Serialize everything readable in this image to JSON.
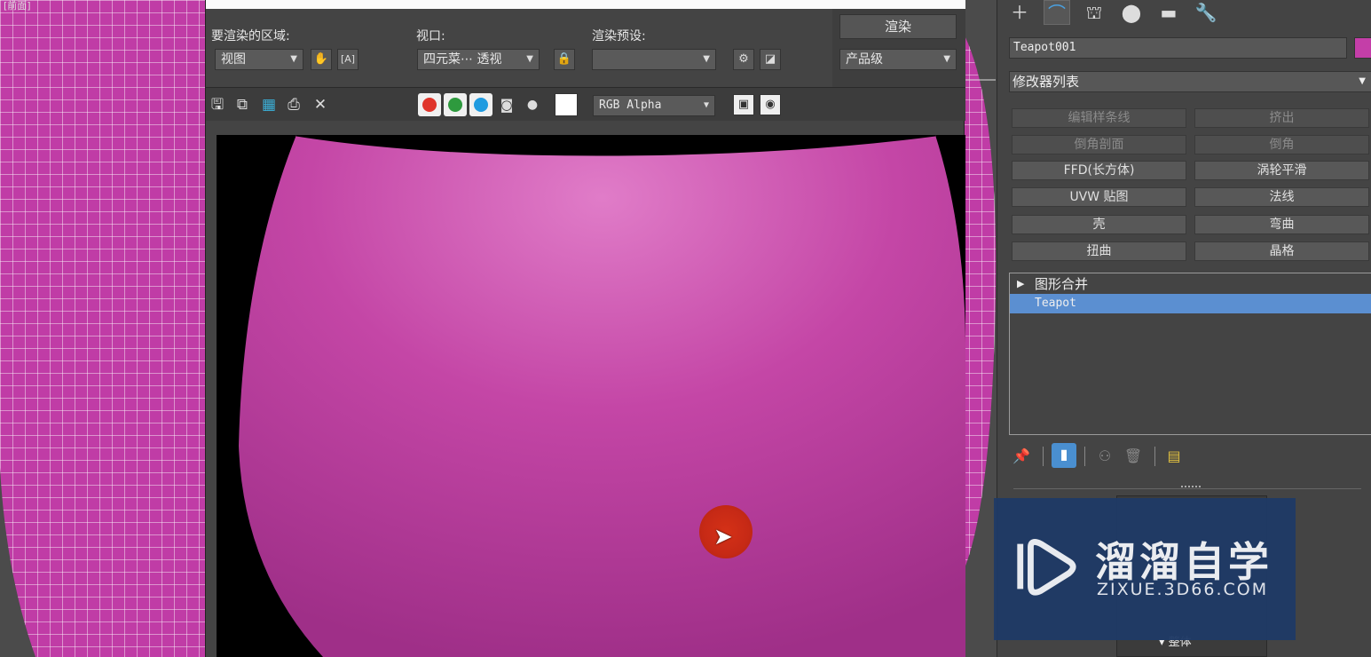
{
  "viewport": {
    "corner_label": "[前面]"
  },
  "frame_window": {
    "region_label": "要渲染的区域:",
    "region_value": "视图",
    "viewport_label": "视口:",
    "viewport_value": "四元菜⋯ 透视",
    "preset_label": "渲染预设:",
    "preset_value": "",
    "render_button": "渲染",
    "quality_value": "产品级",
    "channel_value": "RGB Alpha",
    "colors": {
      "red": "#e0352b",
      "green": "#2e9a3e",
      "blue": "#1f9be0",
      "object": "#c447a8"
    }
  },
  "command_panel": {
    "object_name": "Teapot001",
    "object_color": "#c43ea8",
    "modifier_list_label": "修改器列表",
    "modifier_buttons": [
      {
        "label": "编辑样条线",
        "enabled": false
      },
      {
        "label": "挤出",
        "enabled": false
      },
      {
        "label": "倒角剖面",
        "enabled": false
      },
      {
        "label": "倒角",
        "enabled": false
      },
      {
        "label": "FFD(长方体)",
        "enabled": true
      },
      {
        "label": "涡轮平滑",
        "enabled": true
      },
      {
        "label": "UVW 贴图",
        "enabled": true
      },
      {
        "label": "法线",
        "enabled": true
      },
      {
        "label": "壳",
        "enabled": true
      },
      {
        "label": "弯曲",
        "enabled": true
      },
      {
        "label": "扭曲",
        "enabled": true
      },
      {
        "label": "晶格",
        "enabled": true
      }
    ],
    "stack": [
      {
        "label": "图形合并",
        "selected": false
      },
      {
        "label": "Teapot",
        "selected": true
      }
    ],
    "bottom_rollout_label": "整体"
  },
  "watermark": {
    "title": "溜溜自学",
    "subtitle": "ZIXUE.3D66.COM"
  }
}
